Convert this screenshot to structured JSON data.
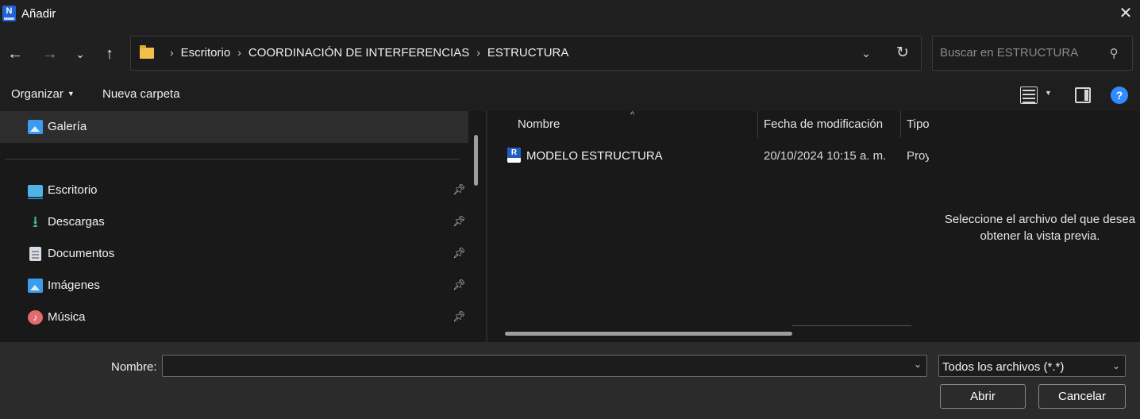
{
  "window": {
    "title": "Añadir",
    "app_icon_letter": "N"
  },
  "nav": {
    "breadcrumb": [
      "Escritorio",
      "COORDINACIÓN DE INTERFERENCIAS",
      "ESTRUCTURA"
    ],
    "search_placeholder": "Buscar en ESTRUCTURA"
  },
  "toolbar": {
    "organize_label": "Organizar",
    "new_folder_label": "Nueva carpeta"
  },
  "sidebar": {
    "items": [
      {
        "label": "Galería",
        "icon": "gallery-icon",
        "pinned": false,
        "selected": true
      },
      {
        "label": "Escritorio",
        "icon": "desktop-icon",
        "pinned": true
      },
      {
        "label": "Descargas",
        "icon": "download-icon",
        "pinned": true
      },
      {
        "label": "Documentos",
        "icon": "documents-icon",
        "pinned": true
      },
      {
        "label": "Imágenes",
        "icon": "images-icon",
        "pinned": true
      },
      {
        "label": "Música",
        "icon": "music-icon",
        "pinned": true
      }
    ]
  },
  "files": {
    "columns": [
      "Nombre",
      "Fecha de modificación",
      "Tipo"
    ],
    "rows": [
      {
        "name": "MODELO ESTRUCTURA",
        "date": "20/10/2024 10:15 a. m.",
        "type": "Proy",
        "icon": "revit-file-icon"
      }
    ]
  },
  "preview": {
    "message": "Seleccione el archivo del que desea obtener la vista previa."
  },
  "footer": {
    "name_label": "Nombre:",
    "name_value": "",
    "filter_value": "Todos los archivos (*.*)",
    "open_label": "Abrir",
    "cancel_label": "Cancelar"
  },
  "colors": {
    "background": "#202020",
    "pane": "#191919",
    "accent": "#2f8cff"
  }
}
